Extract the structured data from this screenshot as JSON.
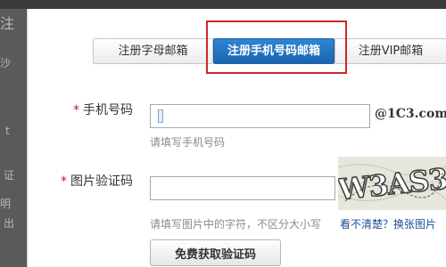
{
  "background": {
    "fragments": [
      "注",
      "沙",
      "证",
      "明",
      "出",
      "t"
    ]
  },
  "tabs": [
    {
      "label": "注册字母邮箱",
      "active": false
    },
    {
      "label": "注册手机号码邮箱",
      "active": true
    },
    {
      "label": "注册VIP邮箱",
      "active": false
    }
  ],
  "form": {
    "required_mark": "*",
    "phone": {
      "label": "手机号码",
      "value": "",
      "placeholder": "",
      "suffix": "@1C3.com",
      "hint": "请填写手机号码"
    },
    "captcha": {
      "label": "图片验证码",
      "value": "",
      "placeholder": "",
      "hint": "请填写图片中的字符，不区分大小写",
      "image_text": "W3AS3",
      "refresh_link": "看不清楚？换张图片"
    },
    "send_code_button": "免费获取验证码"
  },
  "colors": {
    "active_tab": "#1a64b0",
    "highlight_box": "#d1252b",
    "required_mark": "#c4161c",
    "link": "#1a4f95"
  }
}
